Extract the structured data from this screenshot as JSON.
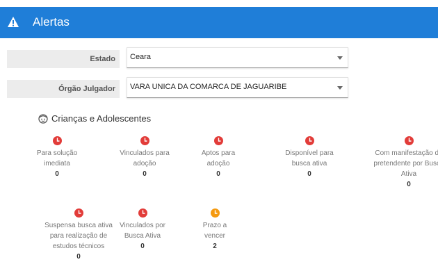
{
  "header": {
    "title": "Alertas",
    "icon": "warning-triangle-icon",
    "color": "#1f7ed8"
  },
  "filters": {
    "estado": {
      "label": "Estado",
      "value": "Ceara"
    },
    "orgao": {
      "label": "Órgão Julgador",
      "value": "VARA UNICA DA COMARCA DE JAGUARIBE"
    }
  },
  "section": {
    "title": "Crianças e Adolescentes",
    "icon": "child-face-icon"
  },
  "alerts": [
    {
      "label": [
        "Para solução",
        "imediata"
      ],
      "count": "0",
      "status": "red",
      "color": "#e23c39"
    },
    {
      "label": [
        "Vinculados para",
        "adoção"
      ],
      "count": "0",
      "status": "red",
      "color": "#e23c39"
    },
    {
      "label": [
        "Aptos para",
        "adoção"
      ],
      "count": "0",
      "status": "red",
      "color": "#e23c39"
    },
    {
      "label": [
        "Disponível para",
        "busca ativa"
      ],
      "count": "0",
      "status": "red",
      "color": "#e23c39"
    },
    {
      "label": [
        "Com manifestação de",
        "pretendente por Busca",
        "Ativa"
      ],
      "count": "0",
      "status": "red",
      "color": "#e23c39"
    },
    {
      "label": [
        "Suspensa busca ativa",
        "para realização de",
        "estudos técnicos"
      ],
      "count": "0",
      "status": "red",
      "color": "#e23c39"
    },
    {
      "label": [
        "Vinculados por",
        "Busca Ativa"
      ],
      "count": "0",
      "status": "red",
      "color": "#e23c39"
    },
    {
      "label": [
        "Prazo a",
        "vencer"
      ],
      "count": "2",
      "status": "orange",
      "color": "#f59a10"
    }
  ]
}
